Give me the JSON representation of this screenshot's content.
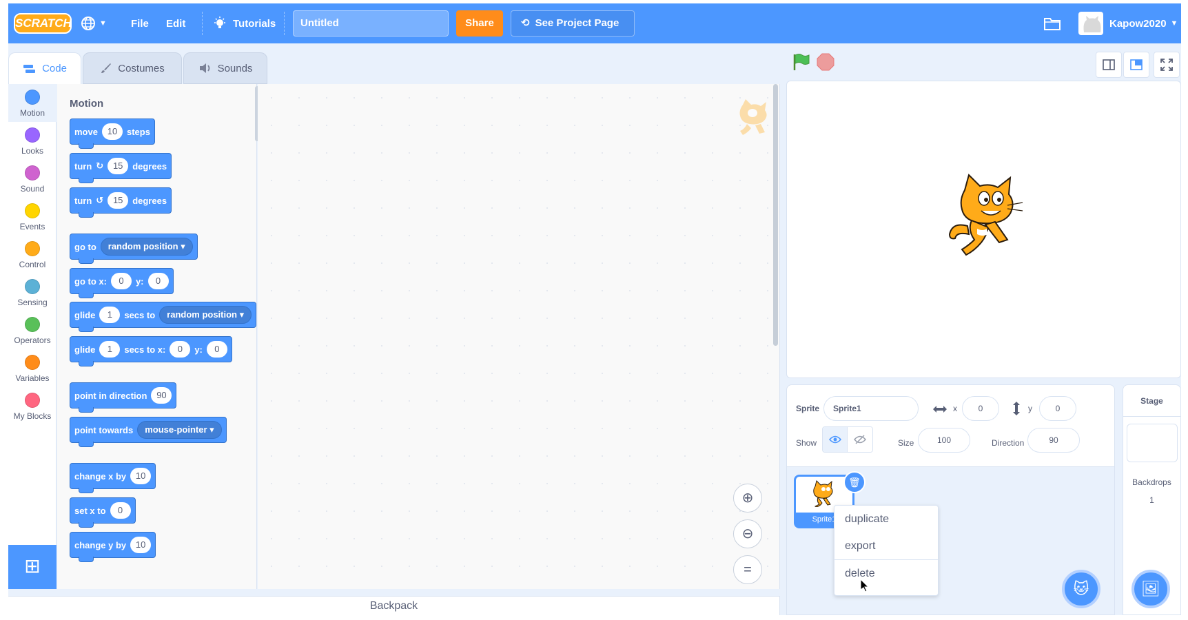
{
  "menu": {
    "logo": "SCRATCH",
    "file": "File",
    "edit": "Edit",
    "tutorials": "Tutorials",
    "project_title": "Untitled",
    "share": "Share",
    "see_project_page": "See Project Page",
    "username": "Kapow2020"
  },
  "tabs": {
    "code": "Code",
    "costumes": "Costumes",
    "sounds": "Sounds"
  },
  "categories": [
    {
      "label": "Motion",
      "color": "#4c97ff"
    },
    {
      "label": "Looks",
      "color": "#9966ff"
    },
    {
      "label": "Sound",
      "color": "#cf63cf"
    },
    {
      "label": "Events",
      "color": "#ffd500"
    },
    {
      "label": "Control",
      "color": "#ffab19"
    },
    {
      "label": "Sensing",
      "color": "#5cb1d6"
    },
    {
      "label": "Operators",
      "color": "#59c059"
    },
    {
      "label": "Variables",
      "color": "#ff8c1a"
    },
    {
      "label": "My Blocks",
      "color": "#ff6680"
    }
  ],
  "palette": {
    "title": "Motion",
    "move": {
      "a": "move",
      "n": "10",
      "b": "steps"
    },
    "turn_right": {
      "a": "turn",
      "n": "15",
      "b": "degrees"
    },
    "turn_left": {
      "a": "turn",
      "n": "15",
      "b": "degrees"
    },
    "go_to": {
      "a": "go to",
      "dd": "random position"
    },
    "go_to_xy": {
      "a": "go to x:",
      "x": "0",
      "b": "y:",
      "y": "0"
    },
    "glide_to": {
      "a": "glide",
      "n": "1",
      "b": "secs to",
      "dd": "random position"
    },
    "glide_xy": {
      "a": "glide",
      "n": "1",
      "b": "secs to x:",
      "x": "0",
      "c": "y:",
      "y": "0"
    },
    "point_dir": {
      "a": "point in direction",
      "n": "90"
    },
    "point_towards": {
      "a": "point towards",
      "dd": "mouse-pointer"
    },
    "change_x": {
      "a": "change x by",
      "n": "10"
    },
    "set_x": {
      "a": "set x to",
      "n": "0"
    },
    "change_y": {
      "a": "change y by",
      "n": "10"
    }
  },
  "backpack": "Backpack",
  "sprite_info": {
    "sprite_label": "Sprite",
    "sprite_name": "Sprite1",
    "x_label": "x",
    "x_value": "0",
    "y_label": "y",
    "y_value": "0",
    "show_label": "Show",
    "size_label": "Size",
    "size_value": "100",
    "direction_label": "Direction",
    "direction_value": "90"
  },
  "sprite_tile": {
    "name": "Sprite1"
  },
  "context_menu": [
    "duplicate",
    "export",
    "delete"
  ],
  "stage_pane": {
    "title": "Stage",
    "backdrops_label": "Backdrops",
    "backdrops_count": "1"
  },
  "colors": {
    "accent": "#4c97ff",
    "share": "#ff8c1a",
    "cat_orange": "#ffab19"
  }
}
